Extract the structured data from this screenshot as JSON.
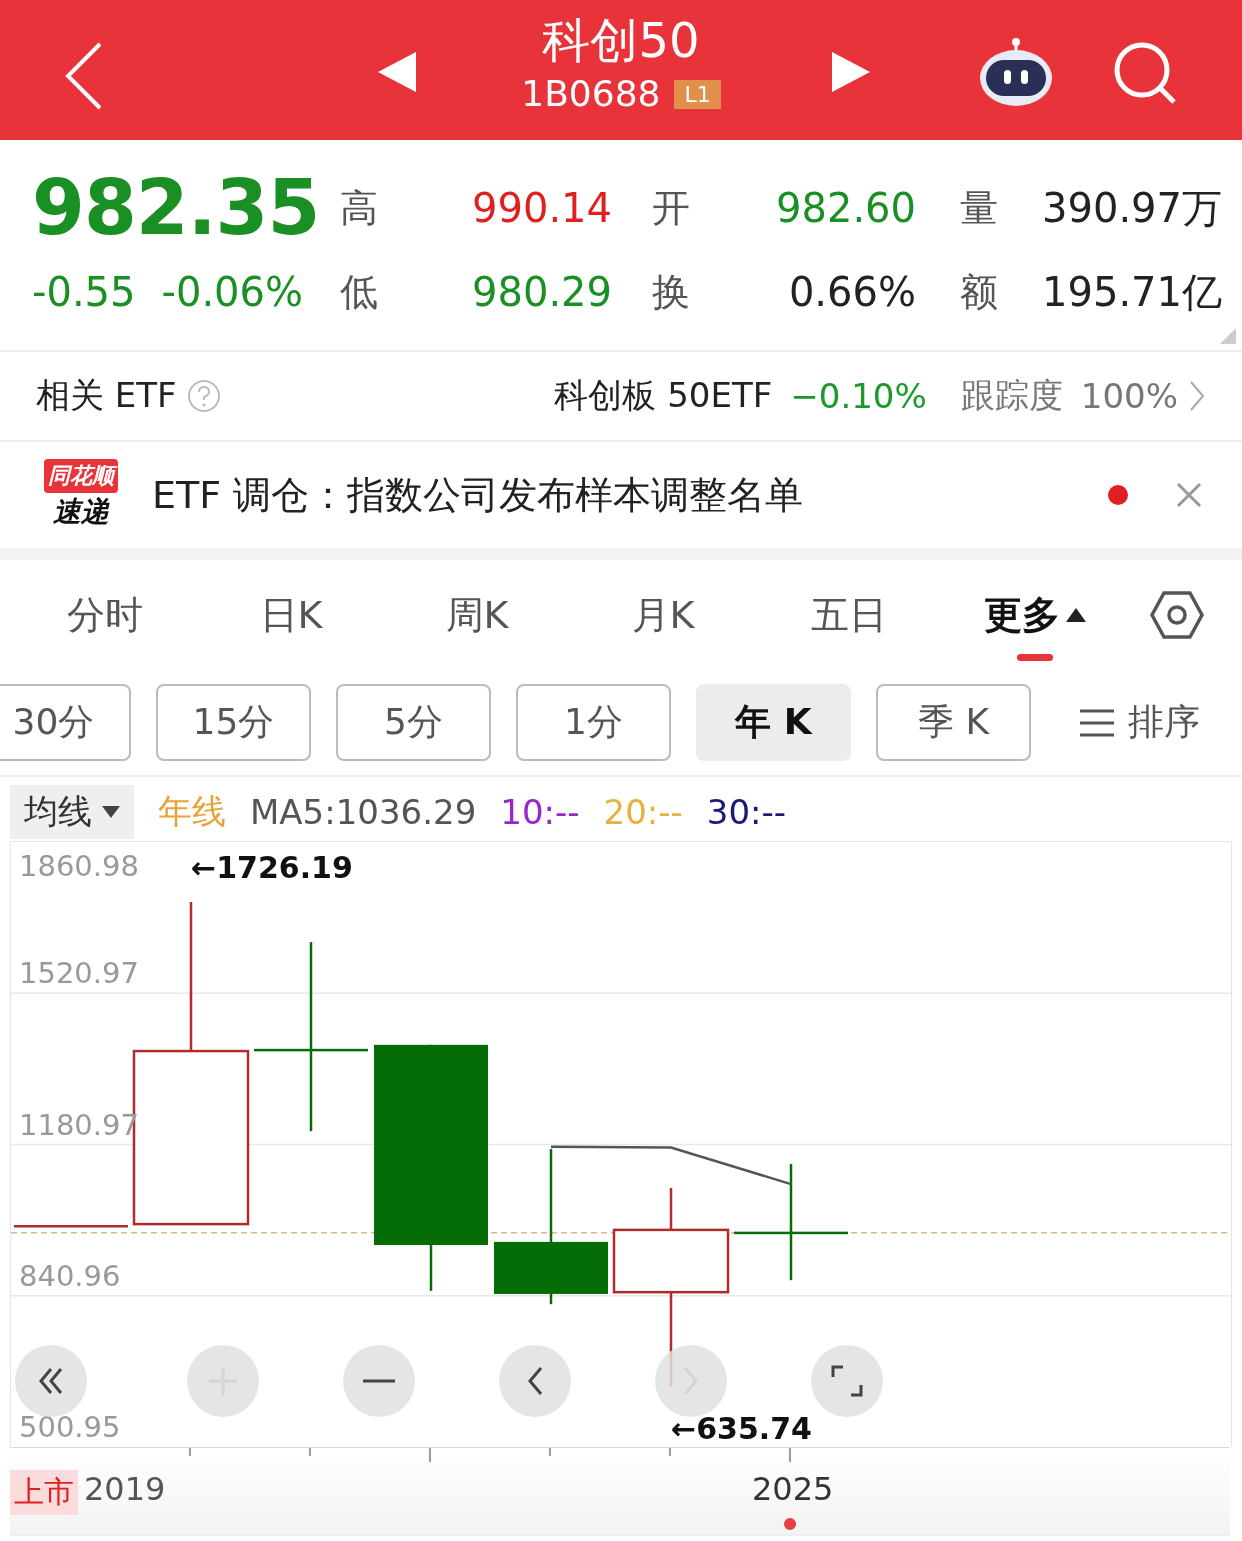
{
  "header": {
    "title": "科创50",
    "code": "1B0688",
    "badge": "L1"
  },
  "quote": {
    "price": "982.35",
    "change": "-0.55",
    "change_pct": "-0.06%",
    "color": "#1a8f24",
    "stats": [
      {
        "label": "高",
        "value": "990.14",
        "color": "#e02020"
      },
      {
        "label": "开",
        "value": "982.60",
        "color": "#1a8f24"
      },
      {
        "label": "量",
        "value": "390.97万",
        "color": "#222222"
      },
      {
        "label": "低",
        "value": "980.29",
        "color": "#1a8f24"
      },
      {
        "label": "换",
        "value": "0.66%",
        "color": "#222222"
      },
      {
        "label": "额",
        "value": "195.71亿",
        "color": "#222222"
      }
    ]
  },
  "related_etf": {
    "label": "相关 ETF",
    "name": "科创板 50ETF",
    "change": "−0.10%",
    "tracking_label": "跟踪度",
    "tracking": "100%"
  },
  "news": {
    "logo_top": "同花顺",
    "logo_bottom": "速递",
    "headline": "ETF 调仓：指数公司发布样本调整名单",
    "unread": true
  },
  "tabs": [
    {
      "label": "分时",
      "selected": false
    },
    {
      "label": "日K",
      "selected": false
    },
    {
      "label": "周K",
      "selected": false
    },
    {
      "label": "月K",
      "selected": false
    },
    {
      "label": "五日",
      "selected": false
    },
    {
      "label": "更多",
      "selected": true,
      "expanded": true
    }
  ],
  "periods": [
    {
      "label": "30分",
      "selected": false
    },
    {
      "label": "15分",
      "selected": false
    },
    {
      "label": "5分",
      "selected": false
    },
    {
      "label": "1分",
      "selected": false
    },
    {
      "label": "年 K",
      "selected": true
    },
    {
      "label": "季 K",
      "selected": false
    }
  ],
  "sort_label": "排序",
  "indicators": {
    "dropdown": "均线",
    "items": [
      {
        "text": "年线",
        "color": "#e8a23a"
      },
      {
        "text": "MA5:1036.29",
        "color": "#555555"
      },
      {
        "text": "10:--",
        "color": "#9b27c9"
      },
      {
        "text": "20:--",
        "color": "#e8b040"
      },
      {
        "text": "30:--",
        "color": "#1a1a7a"
      }
    ]
  },
  "chart": {
    "y_axis_labels": [
      "1860.98",
      "1520.97",
      "1180.97",
      "840.96",
      "500.95"
    ],
    "high_label": "←1726.19",
    "low_label": "←635.74",
    "controls": [
      {
        "kind": "first",
        "disabled": false
      },
      {
        "kind": "zoom-in",
        "disabled": true
      },
      {
        "kind": "zoom-out",
        "disabled": false
      },
      {
        "kind": "prev",
        "disabled": false
      },
      {
        "kind": "next",
        "disabled": true
      },
      {
        "kind": "fullscreen",
        "disabled": false
      }
    ],
    "x_axis": {
      "listed_badge": "上市",
      "start": "2019",
      "end": "2025"
    }
  }
}
